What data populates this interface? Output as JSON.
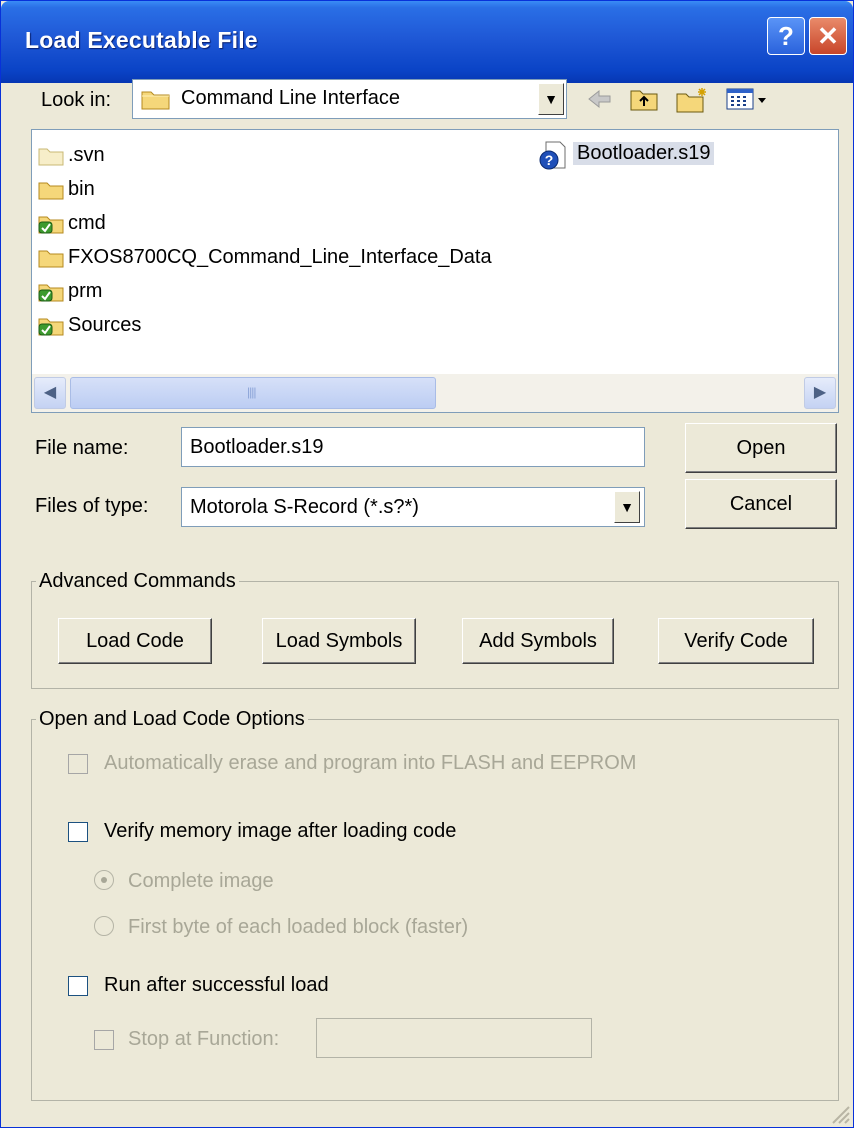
{
  "window": {
    "title": "Load Executable File",
    "help_glyph": "?",
    "close_glyph": "✕"
  },
  "lookin": {
    "label": "Look in:",
    "value": "Command Line Interface"
  },
  "toolbar": {
    "back_icon": "back-arrow-icon",
    "up_icon": "up-folder-icon",
    "new_icon": "new-folder-icon",
    "view_icon": "view-menu-icon"
  },
  "files": {
    "folders": [
      {
        "name": ".svn",
        "icon": "folder-icon"
      },
      {
        "name": "bin",
        "icon": "folder-icon"
      },
      {
        "name": "cmd",
        "icon": "folder-link-icon"
      },
      {
        "name": "FXOS8700CQ_Command_Line_Interface_Data",
        "icon": "folder-icon"
      },
      {
        "name": "prm",
        "icon": "folder-link-icon"
      },
      {
        "name": "Sources",
        "icon": "folder-link-icon"
      }
    ],
    "selected_file": {
      "name": "Bootloader.s19",
      "icon": "unknown-file-icon"
    }
  },
  "form": {
    "filename_label": "File name:",
    "filename_value": "Bootloader.s19",
    "filetype_label": "Files of type:",
    "filetype_value": "Motorola S-Record (*.s?*)",
    "open_label": "Open",
    "cancel_label": "Cancel"
  },
  "advanced": {
    "legend": "Advanced Commands",
    "load_code": "Load Code",
    "load_symbols": "Load Symbols",
    "add_symbols": "Add Symbols",
    "verify_code": "Verify Code"
  },
  "options": {
    "legend": "Open and Load Code Options",
    "auto_erase": "Automatically erase and program into FLASH and EEPROM",
    "verify_memory": "Verify memory image after loading code",
    "complete_image": "Complete image",
    "first_byte": "First byte of each loaded block (faster)",
    "run_after": "Run after successful load",
    "stop_at": "Stop at Function:",
    "stop_at_value": ""
  }
}
